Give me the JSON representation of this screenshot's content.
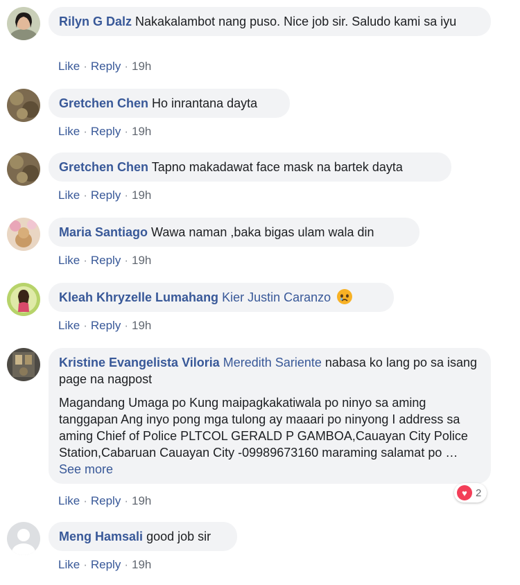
{
  "actions": {
    "like": "Like",
    "reply": "Reply",
    "sep": "·"
  },
  "comments": [
    {
      "author": "Rilyn G Dalz",
      "text": "Nakakalambot nang puso. Nice job sir. Saludo kami sa iyu",
      "time": "19h"
    },
    {
      "author": "Gretchen Chen",
      "text": "Ho inrantana dayta",
      "time": "19h"
    },
    {
      "author": "Gretchen Chen",
      "text": "Tapno makadawat face mask na bartek dayta",
      "time": "19h"
    },
    {
      "author": "Maria Santiago",
      "text": "Wawa naman ,baka bigas ulam wala din",
      "time": "19h"
    },
    {
      "author": "Kleah Khryzelle Lumahang",
      "mention": "Kier Justin Caranzo",
      "emoji": "sad-face-emoji",
      "time": "19h"
    },
    {
      "author": "Kristine Evangelista Viloria",
      "mention": "Meredith Sariente",
      "text": "nabasa ko lang po sa isang page na nagpost",
      "paragraph": "Magandang Umaga po Kung maipagkakatiwala po ninyo sa aming tanggapan Ang inyo pong mga tulong ay maaari po ninyong I address sa aming Chief of Police PLTCOL GERALD P GAMBOA,Cauayan City Police Station,Cabaruan Cauayan City -09989673160 maraming salamat po …",
      "see_more": "See more",
      "reaction_count": "2",
      "time": "19h"
    },
    {
      "author": "Meng Hamsali",
      "text": "good job sir",
      "time": "19h"
    }
  ]
}
